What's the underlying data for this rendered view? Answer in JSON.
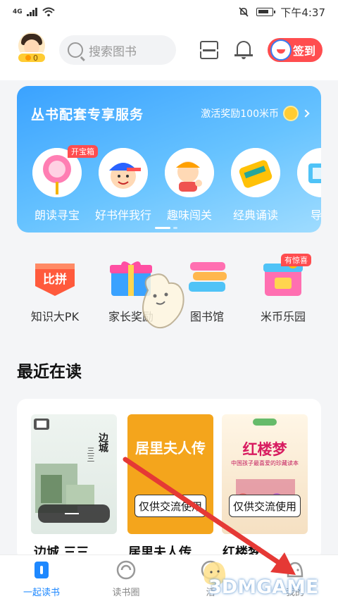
{
  "status_bar": {
    "network": "4G",
    "time": "下午4:37"
  },
  "header": {
    "coins": "0",
    "search_placeholder": "搜索图书",
    "signin_label": "签到"
  },
  "banner": {
    "title": "丛书配套专享服务",
    "reward_text": "激活奖励100米币",
    "chest_tag": "开宝箱",
    "features": [
      {
        "label": "朗读寻宝"
      },
      {
        "label": "好书伴我行"
      },
      {
        "label": "趣味闯关"
      },
      {
        "label": "经典诵读"
      },
      {
        "label": "导读"
      }
    ]
  },
  "quick_actions": {
    "items": [
      {
        "label": "知识大PK",
        "art_text": "比拼"
      },
      {
        "label": "家长奖励"
      },
      {
        "label": "图书馆"
      },
      {
        "label": "米币乐园"
      }
    ],
    "surprise_tag": "有惊喜"
  },
  "recent": {
    "section_title": "最近在读",
    "books": [
      {
        "title": "边城 三三",
        "cover_title": "边城",
        "cover_sub": "三三"
      },
      {
        "title": "居里夫人传",
        "cover_title": "居里夫人传",
        "sample_label": "仅供交流使用"
      },
      {
        "title": "红楼梦",
        "cover_title": "红楼梦",
        "cover_sub": "中国孩子最喜爱的珍藏读本",
        "sample_label": "仅供交流使用"
      }
    ]
  },
  "tabbar": {
    "tabs": [
      {
        "label": "一起读书"
      },
      {
        "label": "读书圈"
      },
      {
        "label": "活"
      },
      {
        "label": "我的"
      }
    ]
  },
  "watermark": "3DMGAME",
  "colors": {
    "accent": "#1e88ff",
    "signin": "#ff4d4f",
    "banner": "#3aa2ff",
    "arrow": "#e53935"
  }
}
